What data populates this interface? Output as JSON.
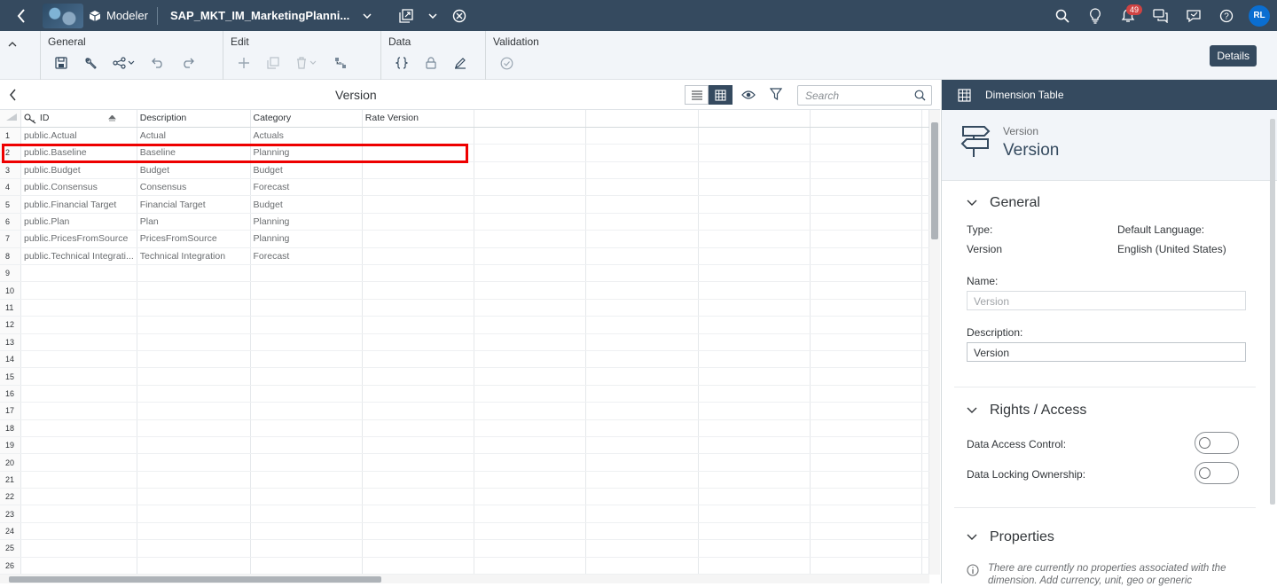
{
  "shell": {
    "app_name": "Modeler",
    "model_name": "SAP_MKT_IM_MarketingPlanni...",
    "notification_count": "49",
    "user_initials": "RL"
  },
  "toolbar": {
    "groups": [
      {
        "title": "General"
      },
      {
        "title": "Edit"
      },
      {
        "title": "Data"
      },
      {
        "title": "Validation"
      }
    ],
    "details_label": "Details"
  },
  "grid": {
    "title": "Version",
    "search_placeholder": "Search",
    "columns": [
      "ID",
      "Description",
      "Category",
      "Rate Version"
    ],
    "rows": [
      {
        "n": "1",
        "id": "public.Actual",
        "desc": "Actual",
        "cat": "Actuals"
      },
      {
        "n": "2",
        "id": "public.Baseline",
        "desc": "Baseline",
        "cat": "Planning"
      },
      {
        "n": "3",
        "id": "public.Budget",
        "desc": "Budget",
        "cat": "Budget"
      },
      {
        "n": "4",
        "id": "public.Consensus",
        "desc": "Consensus",
        "cat": "Forecast"
      },
      {
        "n": "5",
        "id": "public.Financial Target",
        "desc": "Financial Target",
        "cat": "Budget"
      },
      {
        "n": "6",
        "id": "public.Plan",
        "desc": "Plan",
        "cat": "Planning"
      },
      {
        "n": "7",
        "id": "public.PricesFromSource",
        "desc": "PricesFromSource",
        "cat": "Planning"
      },
      {
        "n": "8",
        "id": "public.Technical Integrati...",
        "desc": "Technical Integration",
        "cat": "Forecast"
      }
    ],
    "empty_rows": [
      "9",
      "10",
      "11",
      "12",
      "13",
      "14",
      "15",
      "16",
      "17",
      "18",
      "19",
      "20",
      "21",
      "22",
      "23",
      "24",
      "25",
      "26"
    ]
  },
  "panel": {
    "header": "Dimension Table",
    "object_type": "Version",
    "object_name": "Version",
    "general": {
      "title": "General",
      "type_label": "Type:",
      "type_value": "Version",
      "lang_label": "Default Language:",
      "lang_value": "English (United States)",
      "name_label": "Name:",
      "name_value": "Version",
      "desc_label": "Description:",
      "desc_value": "Version"
    },
    "rights": {
      "title": "Rights / Access",
      "dac_label": "Data Access Control:",
      "dlo_label": "Data Locking Ownership:"
    },
    "properties": {
      "title": "Properties",
      "info": "There are currently no properties associated with the dimension. Add currency, unit, geo or generic"
    }
  }
}
